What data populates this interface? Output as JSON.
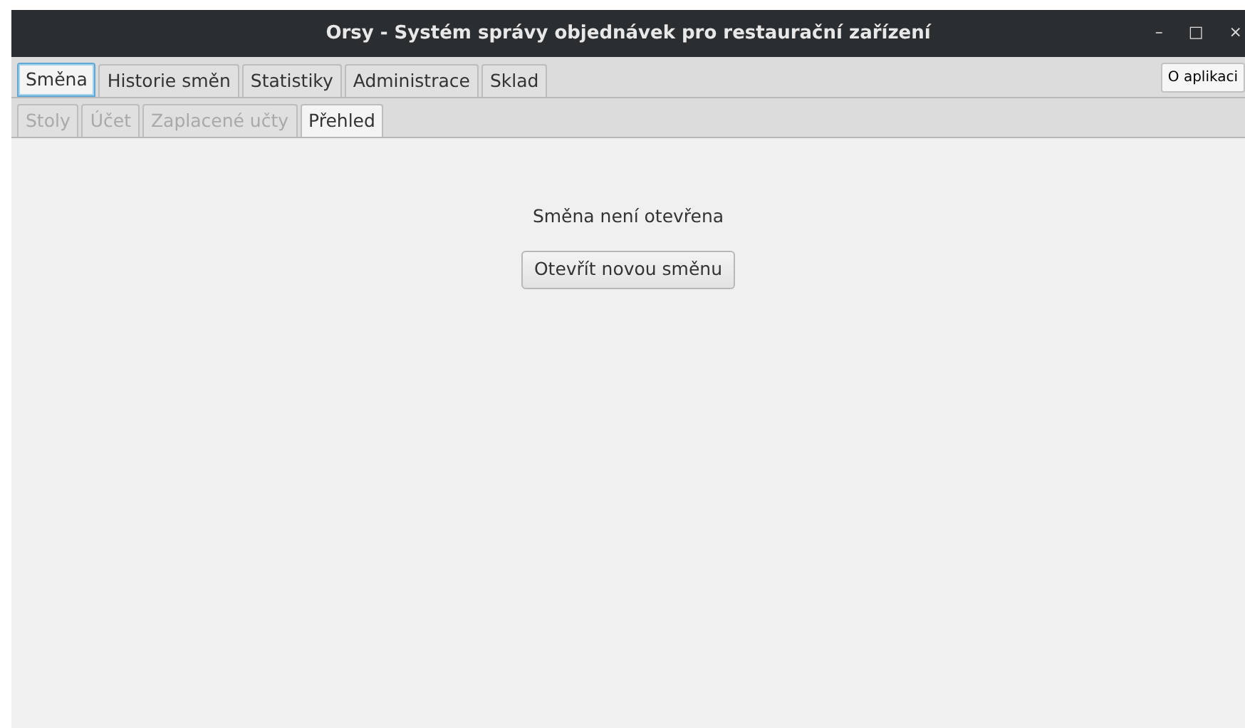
{
  "window": {
    "title": "Orsy - Systém správy objednávek pro restaurační zařízení",
    "controls": [
      "–",
      "□",
      "×"
    ]
  },
  "tabs": [
    {
      "label": "Směna",
      "selected": true
    },
    {
      "label": "Historie směn",
      "selected": false
    },
    {
      "label": "Statistiky",
      "selected": false
    },
    {
      "label": "Administrace",
      "selected": false
    },
    {
      "label": "Sklad",
      "selected": false
    }
  ],
  "about_button": "O aplikaci",
  "subtabs": [
    {
      "label": "Stoly",
      "selected": false,
      "disabled": true
    },
    {
      "label": "Účet",
      "selected": false,
      "disabled": true
    },
    {
      "label": "Zaplacené učty",
      "selected": false,
      "disabled": true
    },
    {
      "label": "Přehled",
      "selected": true,
      "disabled": false
    }
  ],
  "content": {
    "message": "Směna není otevřena",
    "button": "Otevřít novou směnu"
  }
}
